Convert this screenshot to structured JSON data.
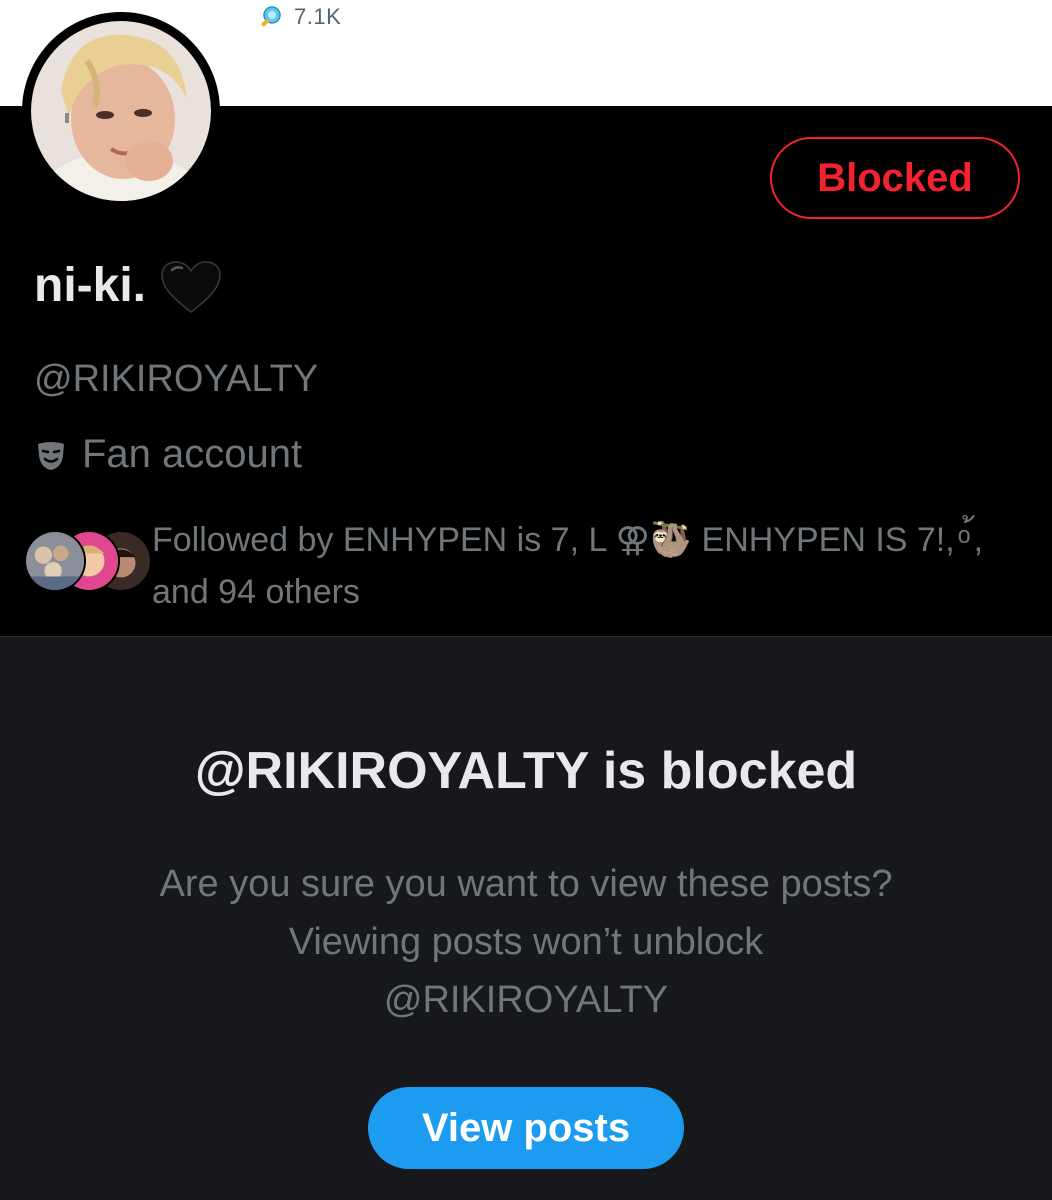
{
  "top_stat": {
    "icon": "magnifier-icon",
    "value": "7.1K"
  },
  "profile": {
    "avatar": "avatar",
    "blocked_label": "Blocked",
    "display_name": "ni-ki.",
    "name_emoji": "black-heart-icon",
    "handle": "@RIKIROYALTY",
    "category": {
      "icon": "theater-mask-icon",
      "label": "Fan account"
    },
    "followed_by": "Followed by ENHYPEN is 7, L ⚢🦥 ENHYPEN IS 7!, ͦ ้, and 94 others"
  },
  "blocked_notice": {
    "title": "@RIKIROYALTY is blocked",
    "message": "Are you sure you want to view these posts? Viewing posts won’t unblock @RIKIROYALTY",
    "button_label": "View posts"
  },
  "colors": {
    "accent_blue": "#1d9bf0",
    "blocked_red": "#f4212e",
    "text_primary": "#e7e9ea",
    "text_secondary": "#71767b",
    "panel_bg": "#16181c"
  }
}
